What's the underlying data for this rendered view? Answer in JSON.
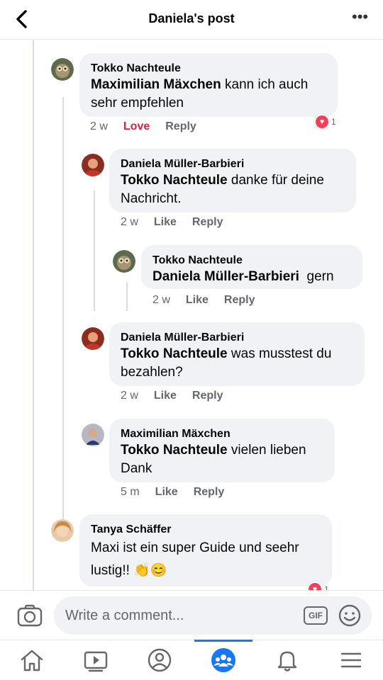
{
  "header": {
    "title": "Daniela's post",
    "more_glyph": "•••"
  },
  "colors": {
    "accent": "#1877f2",
    "love": "#e41e3f",
    "bubble": "#f0f2f5",
    "meta": "#65676b"
  },
  "comments": [
    {
      "author": "Tokko Nachteule",
      "mention": "Maximilian Mäxchen",
      "text": " kann ich auch sehr empfehlen",
      "time": "2 w",
      "action1": "Love",
      "action2": "Reply",
      "reaction_count": "1"
    },
    {
      "author": "Daniela Müller-Barbieri",
      "mention": "Tokko Nachteule",
      "text": " danke für deine Nachricht.",
      "time": "2 w",
      "action1": "Like",
      "action2": "Reply"
    },
    {
      "author": "Tokko Nachteule",
      "mention": "Daniela Müller-Barbieri",
      "text": "  gern",
      "time": "2 w",
      "action1": "Like",
      "action2": "Reply"
    },
    {
      "author": "Daniela Müller-Barbieri",
      "mention": "Tokko Nachteule",
      "text": " was musstest du bezahlen?",
      "time": "2 w",
      "action1": "Like",
      "action2": "Reply"
    },
    {
      "author": "Maximilian Mäxchen",
      "mention": "Tokko Nachteule",
      "text": " vielen lieben Dank",
      "time": "5 m",
      "action1": "Like",
      "action2": "Reply"
    },
    {
      "author": "Tanya Schäffer",
      "text": "Maxi ist ein super Guide und seehr lustig!! 👏😊",
      "reaction_count": "1"
    }
  ],
  "composer": {
    "placeholder": "Write a comment...",
    "gif_label": "GIF"
  },
  "tabs": [
    "home-icon",
    "video-icon",
    "profile-icon",
    "groups-icon",
    "bell-icon",
    "menu-icon"
  ]
}
